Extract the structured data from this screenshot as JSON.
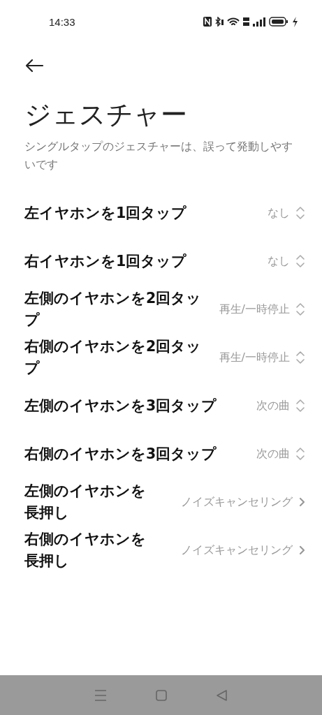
{
  "status_bar": {
    "time": "14:33"
  },
  "title": "ジェスチャー",
  "description": "シングルタップのジェスチャーは、誤って発動しやすいです",
  "settings": [
    {
      "kind": "picker",
      "label": "左イヤホンを1回タップ",
      "value": "なし"
    },
    {
      "kind": "picker",
      "label": "右イヤホンを1回タップ",
      "value": "なし"
    },
    {
      "kind": "picker",
      "label": "左側のイヤホンを2回タップ",
      "value": "再生/一時停止"
    },
    {
      "kind": "picker",
      "label": "右側のイヤホンを2回タップ",
      "value": "再生/一時停止"
    },
    {
      "kind": "picker",
      "label": "左側のイヤホンを3回タップ",
      "value": "次の曲"
    },
    {
      "kind": "picker",
      "label": "右側のイヤホンを3回タップ",
      "value": "次の曲"
    },
    {
      "kind": "link",
      "label": "左側のイヤホンを長押し",
      "value": "ノイズキャンセリング"
    },
    {
      "kind": "link",
      "label": "右側のイヤホンを長押し",
      "value": "ノイズキャンセリング"
    }
  ]
}
